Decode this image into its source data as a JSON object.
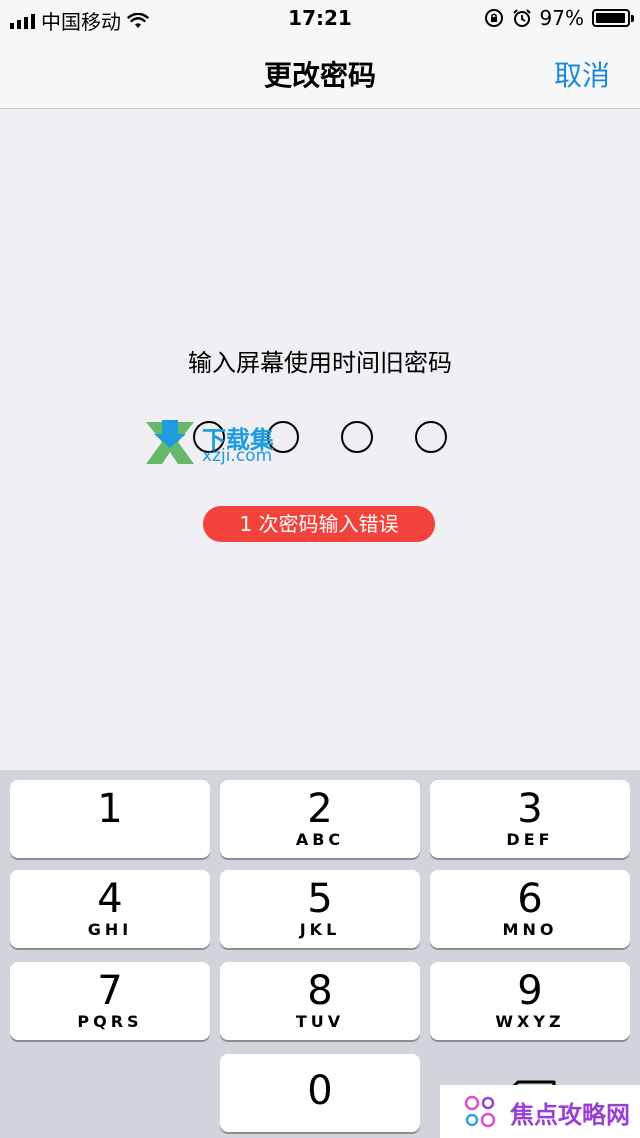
{
  "status_bar": {
    "carrier": "中国移动",
    "time": "17:21",
    "battery": "97%",
    "battery_level": 0.97
  },
  "nav": {
    "title": "更改密码",
    "cancel_label": "取消"
  },
  "main": {
    "prompt": "输入屏幕使用时间旧密码",
    "error_message": "1 次密码输入错误",
    "passcode_slots": 4
  },
  "watermark": {
    "title": "下载集",
    "subtitle": "xzji.com"
  },
  "keypad": {
    "keys": [
      {
        "num": "1",
        "letters": ""
      },
      {
        "num": "2",
        "letters": "ABC"
      },
      {
        "num": "3",
        "letters": "DEF"
      },
      {
        "num": "4",
        "letters": "GHI"
      },
      {
        "num": "5",
        "letters": "JKL"
      },
      {
        "num": "6",
        "letters": "MNO"
      },
      {
        "num": "7",
        "letters": "PQRS"
      },
      {
        "num": "8",
        "letters": "TUV"
      },
      {
        "num": "9",
        "letters": "WXYZ"
      },
      {
        "num": "0",
        "letters": ""
      }
    ]
  },
  "badge": {
    "text": "焦点攻略网"
  },
  "colors": {
    "accent": "#1a8ad8",
    "error": "#f3423b",
    "keyboard_bg": "#d1d4da"
  }
}
